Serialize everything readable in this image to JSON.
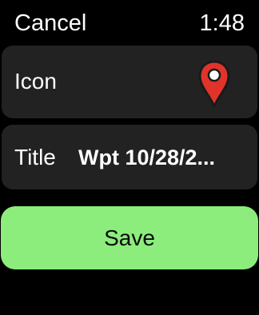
{
  "status_bar": {
    "cancel_label": "Cancel",
    "time": "1:48"
  },
  "icon_row": {
    "label": "Icon",
    "icon_name": "map-pin-icon",
    "pin_color": "#e0342a"
  },
  "title_row": {
    "label": "Title",
    "value": "Wpt 10/28/2..."
  },
  "save": {
    "label": "Save",
    "color": "#8ced7c"
  }
}
